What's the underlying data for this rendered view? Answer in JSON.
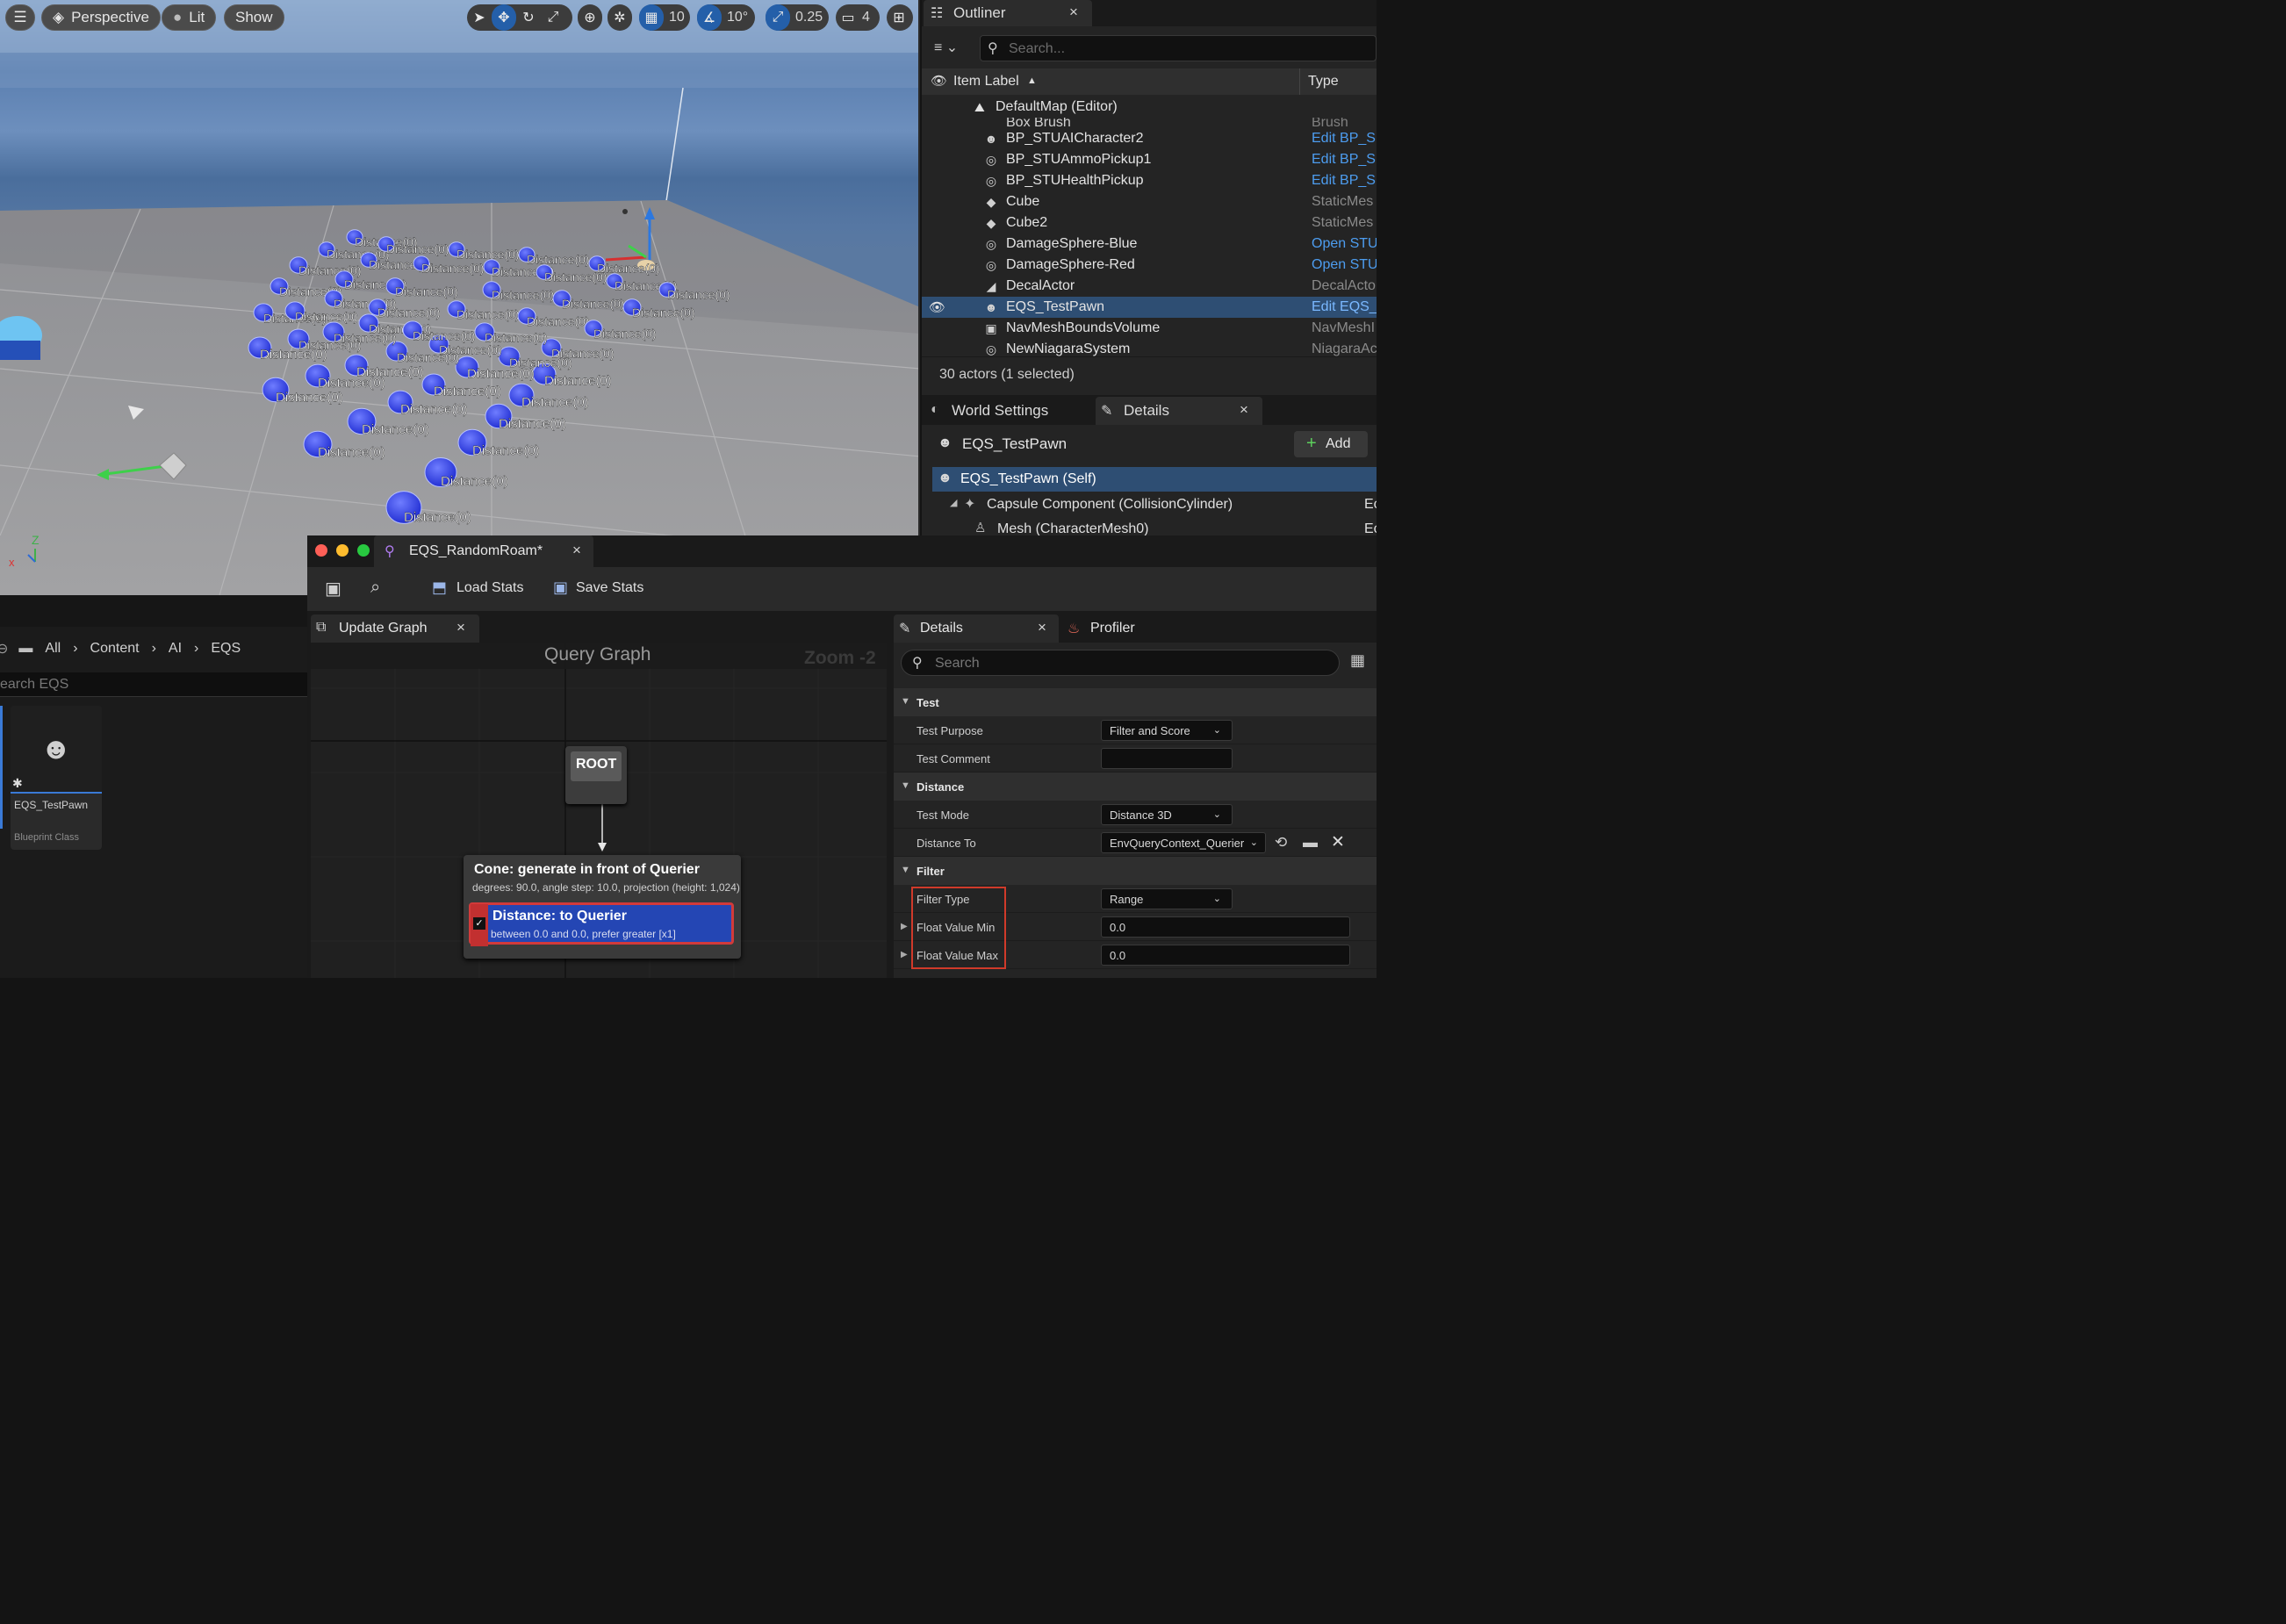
{
  "viewport": {
    "perspective_label": "Perspective",
    "lit_label": "Lit",
    "show_label": "Show",
    "grid_snap_value": "10",
    "rotation_snap_value": "10°",
    "scale_snap_value": "0.25",
    "camera_speed_value": "4",
    "debug_label": "Distance(0)",
    "accent_color": "#245fa9"
  },
  "outliner": {
    "tab_label": "Outliner",
    "search_placeholder": "Search...",
    "col_item_label": "Item Label",
    "col_type": "Type",
    "root_label": "DefaultMap (Editor)",
    "partial_row": {
      "label": "Box Brush",
      "type": "Brush"
    },
    "rows": [
      {
        "label": "BP_STUAICharacter2",
        "type": "Edit BP_S",
        "icon": "pawn-icon",
        "link": true
      },
      {
        "label": "BP_STUAmmoPickup1",
        "type": "Edit BP_S",
        "icon": "actor-icon",
        "link": true
      },
      {
        "label": "BP_STUHealthPickup",
        "type": "Edit BP_S",
        "icon": "actor-icon",
        "link": true
      },
      {
        "label": "Cube",
        "type": "StaticMes",
        "icon": "cube-icon",
        "link": false
      },
      {
        "label": "Cube2",
        "type": "StaticMes",
        "icon": "cube-icon",
        "link": false
      },
      {
        "label": "DamageSphere-Blue",
        "type": "Open STU",
        "icon": "actor-icon",
        "link": true
      },
      {
        "label": "DamageSphere-Red",
        "type": "Open STU",
        "icon": "actor-icon",
        "link": true
      },
      {
        "label": "DecalActor",
        "type": "DecalActo",
        "icon": "decal-icon",
        "link": false
      },
      {
        "label": "EQS_TestPawn",
        "type": "Edit EQS_",
        "icon": "pawn-icon",
        "link": true,
        "selected": true
      },
      {
        "label": "NavMeshBoundsVolume",
        "type": "NavMeshI",
        "icon": "volume-icon",
        "link": false
      },
      {
        "label": "NewNiagaraSystem",
        "type": "NiagaraAc",
        "icon": "actor-icon",
        "link": false
      }
    ],
    "status": "30 actors (1 selected)"
  },
  "level_details": {
    "tab_world_settings": "World Settings",
    "tab_details": "Details",
    "actor_name": "EQS_TestPawn",
    "add_label": "Add",
    "components": [
      {
        "label": "EQS_TestPawn (Self)",
        "type": ""
      },
      {
        "label": "Capsule Component (CollisionCylinder)",
        "type": "Ec"
      },
      {
        "label": "Mesh (CharacterMesh0)",
        "type": "Ec"
      }
    ]
  },
  "content_browser": {
    "breadcrumb": [
      "All",
      "Content",
      "AI",
      "EQS"
    ],
    "search_placeholder": "earch EQS",
    "asset_name": "EQS_TestPawn",
    "asset_type": "Blueprint Class"
  },
  "eqs_editor": {
    "window_title": "EQS_RandomRoam*",
    "load_stats": "Load Stats",
    "save_stats": "Save Stats",
    "graph_tab": "Update Graph",
    "graph_title": "Query Graph",
    "zoom": "Zoom -2",
    "root_label": "ROOT",
    "generator_title": "Cone: generate in front of Querier",
    "generator_desc": "degrees: 90.0, angle step: 10.0, projection (height: 1,024)",
    "test_title": "Distance: to Querier",
    "test_desc": "between 0.0 and 0.0, prefer greater [x1]"
  },
  "test_details": {
    "tab_details": "Details",
    "tab_profiler": "Profiler",
    "search_placeholder": "Search",
    "cat_test": "Test",
    "test_purpose_label": "Test Purpose",
    "test_purpose_value": "Filter and Score",
    "test_comment_label": "Test Comment",
    "test_comment_value": "",
    "cat_distance": "Distance",
    "test_mode_label": "Test Mode",
    "test_mode_value": "Distance 3D",
    "distance_to_label": "Distance To",
    "distance_to_value": "EnvQueryContext_Querier",
    "cat_filter": "Filter",
    "filter_type_label": "Filter Type",
    "filter_type_value": "Range",
    "float_min_label": "Float Value Min",
    "float_min_value": "0.0",
    "float_max_label": "Float Value Max",
    "float_max_value": "0.0",
    "highlight_color": "#d03a2a"
  }
}
